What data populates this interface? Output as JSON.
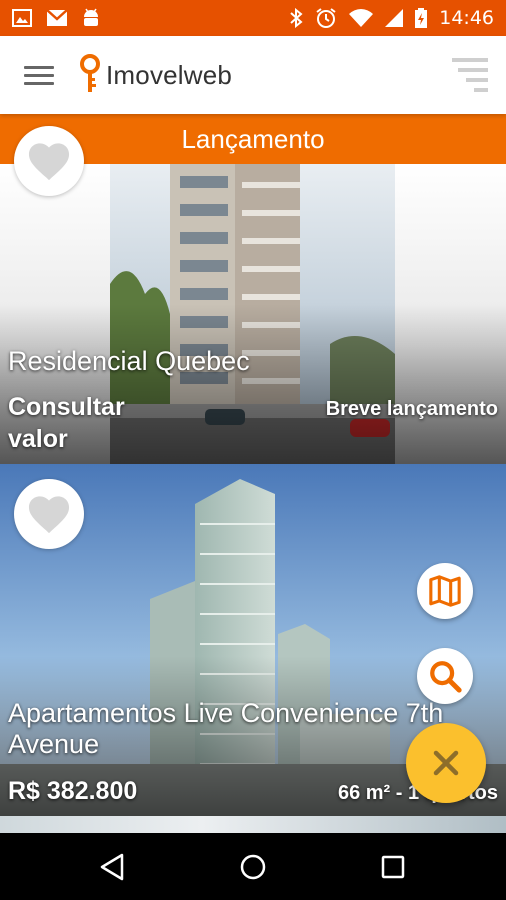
{
  "status_bar": {
    "time": "14:46",
    "left_icons": [
      "image-icon",
      "gmail-icon",
      "android-icon"
    ],
    "right_icons": [
      "bluetooth-icon",
      "alarm-icon",
      "wifi-icon",
      "signal-icon",
      "battery-icon"
    ]
  },
  "app_bar": {
    "logo_text": "Imovelweb",
    "menu_icon": "hamburger-menu-icon",
    "filter_icon": "filter-sort-icon"
  },
  "listings": [
    {
      "banner": "Lançamento",
      "title": "Residencial Quebec",
      "price": "Consultar valor",
      "price_line1": "Consultar",
      "price_line2": "valor",
      "status": "Breve lançamento"
    },
    {
      "title_line1": "Apartamentos Live Convenience 7th",
      "title_line2": "Avenue",
      "price": "R$ 382.800",
      "details": "66  m² - 1 quartos"
    }
  ],
  "actions": {
    "map_icon": "map-icon",
    "search_icon": "search-icon",
    "close_icon": "close-icon"
  },
  "colors": {
    "status_bar": "#e65100",
    "accent": "#ef6c00",
    "fab": "#fbc02d",
    "fab_icon": "#8d6e2a"
  },
  "nav_bar": [
    "back-icon",
    "home-icon",
    "recents-icon"
  ]
}
